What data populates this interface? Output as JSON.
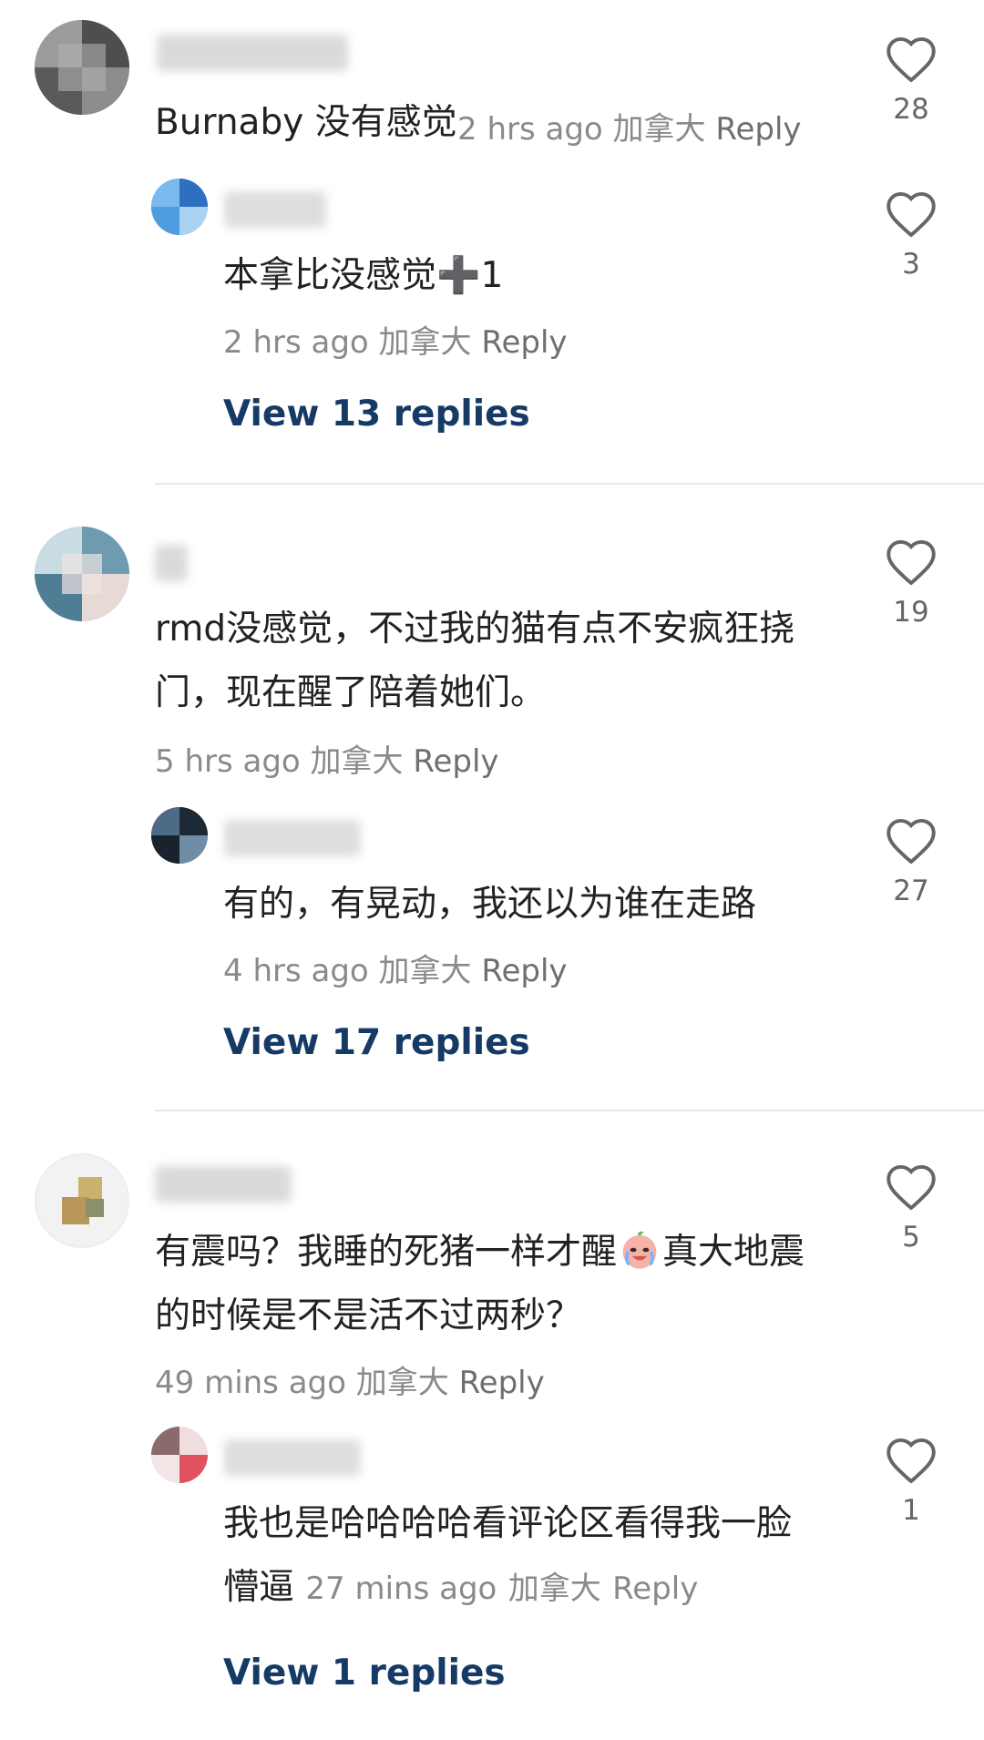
{
  "comments": [
    {
      "text": "Burnaby 没有感觉",
      "meta": {
        "time": "2 hrs ago",
        "location": "加拿大",
        "reply": "Reply"
      },
      "likes": "28",
      "reply": {
        "text": "本拿比没感觉➕1",
        "meta": {
          "time": "2 hrs ago",
          "location": "加拿大",
          "reply": "Reply"
        },
        "likes": "3"
      },
      "view_replies": "View 13 replies"
    },
    {
      "text_line1": "rmd没感觉，不过我的猫有点不安疯狂挠",
      "text_line2": "门，现在醒了陪着她们。",
      "meta": {
        "time": "5 hrs ago",
        "location": "加拿大",
        "reply": "Reply"
      },
      "likes": "19",
      "reply": {
        "text": "有的，有晃动，我还以为谁在走路",
        "meta": {
          "time": "4 hrs ago",
          "location": "加拿大",
          "reply": "Reply"
        },
        "likes": "27"
      },
      "view_replies": "View 17 replies"
    },
    {
      "text_line1_a": "有震吗？我睡的死猪一样才醒",
      "text_line1_b": "真大地震",
      "text_line2": "的时候是不是活不过两秒？",
      "meta": {
        "time": "49 mins ago",
        "location": "加拿大",
        "reply": "Reply"
      },
      "likes": "5",
      "reply": {
        "text_line1": "我也是哈哈哈哈看评论区看得我一脸",
        "text_line2": "懵逼",
        "meta": {
          "time": "27 mins ago",
          "location": "加拿大",
          "reply": "Reply"
        },
        "likes": "1"
      },
      "view_replies": "View 1 replies"
    }
  ],
  "icons": {
    "like": "heart-outline-icon",
    "crying_emoji": "crying-face-emoji"
  },
  "colors": {
    "view_replies": "#163a66",
    "meta": "#8a8a8a",
    "text": "#222222"
  }
}
